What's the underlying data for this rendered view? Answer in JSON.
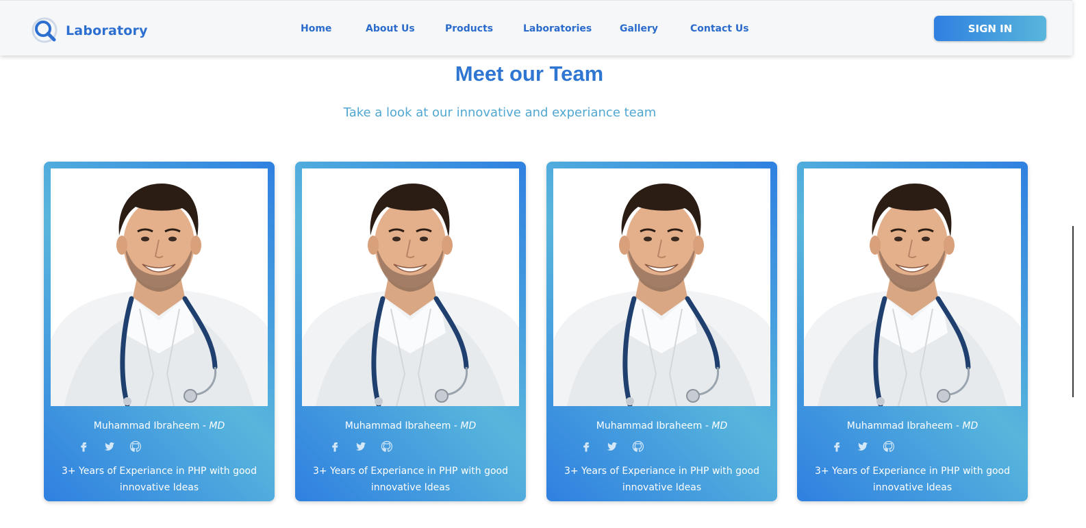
{
  "brand": {
    "name": "Laboratory",
    "icon": "magnifier-logo-icon"
  },
  "nav": {
    "items": [
      {
        "label": "Home"
      },
      {
        "label": "About Us"
      },
      {
        "label": "Products"
      },
      {
        "label": "Laboratories"
      },
      {
        "label": "Gallery"
      },
      {
        "label": "Contact Us"
      }
    ],
    "sign_in_label": "SIGN IN"
  },
  "team": {
    "title": "Meet our Team",
    "subtitle": "Take a look at our innovative and experiance team",
    "members": [
      {
        "name": "Muhammad Ibraheem",
        "separator": " - ",
        "title": "MD",
        "description": "3+ Years of Experiance in PHP with good innovative Ideas",
        "socials": [
          "facebook-icon",
          "twitter-icon",
          "github-icon"
        ]
      },
      {
        "name": "Muhammad Ibraheem",
        "separator": " - ",
        "title": "MD",
        "description": "3+ Years of Experiance in PHP with good innovative Ideas",
        "socials": [
          "facebook-icon",
          "twitter-icon",
          "github-icon"
        ]
      },
      {
        "name": "Muhammad Ibraheem",
        "separator": " - ",
        "title": "MD",
        "description": "3+ Years of Experiance in PHP with good innovative Ideas",
        "socials": [
          "facebook-icon",
          "twitter-icon",
          "github-icon"
        ]
      },
      {
        "name": "Muhammad Ibraheem",
        "separator": " - ",
        "title": "MD",
        "description": "3+ Years of Experiance in PHP with good innovative Ideas",
        "socials": [
          "facebook-icon",
          "twitter-icon",
          "github-icon"
        ]
      }
    ]
  },
  "colors": {
    "brand_blue": "#2d6fd0",
    "nav_blue": "#2b6bcc",
    "gradient_start": "#2f80e0",
    "gradient_end": "#58b6dc",
    "subtitle": "#4fa7d1"
  }
}
